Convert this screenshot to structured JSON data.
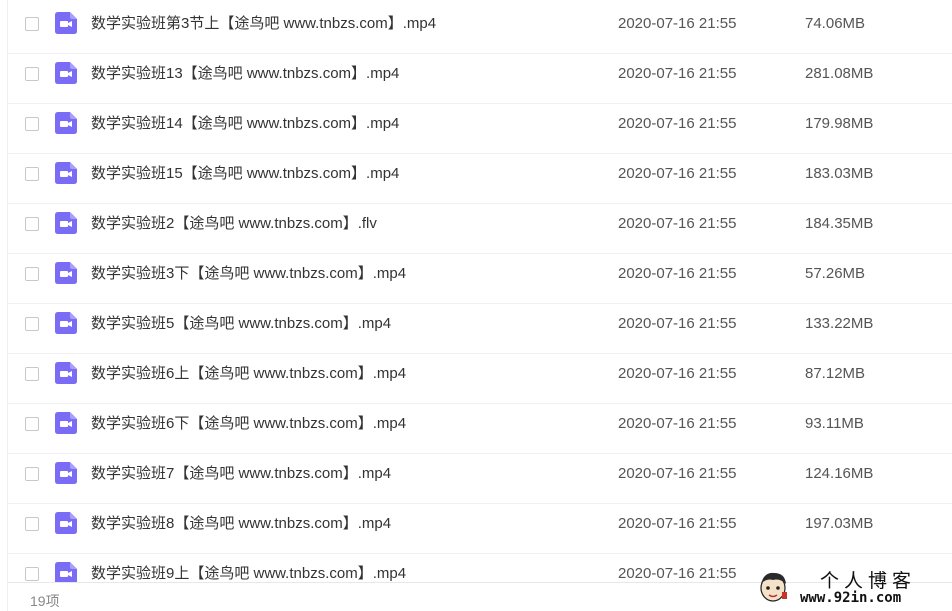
{
  "files": [
    {
      "name": "数学实验班第3节上【途鸟吧 www.tnbzs.com】.mp4",
      "date": "2020-07-16 21:55",
      "size": "74.06MB"
    },
    {
      "name": "数学实验班13【途鸟吧 www.tnbzs.com】.mp4",
      "date": "2020-07-16 21:55",
      "size": "281.08MB"
    },
    {
      "name": "数学实验班14【途鸟吧 www.tnbzs.com】.mp4",
      "date": "2020-07-16 21:55",
      "size": "179.98MB"
    },
    {
      "name": "数学实验班15【途鸟吧 www.tnbzs.com】.mp4",
      "date": "2020-07-16 21:55",
      "size": "183.03MB"
    },
    {
      "name": "数学实验班2【途鸟吧 www.tnbzs.com】.flv",
      "date": "2020-07-16 21:55",
      "size": "184.35MB"
    },
    {
      "name": "数学实验班3下【途鸟吧 www.tnbzs.com】.mp4",
      "date": "2020-07-16 21:55",
      "size": "57.26MB"
    },
    {
      "name": "数学实验班5【途鸟吧 www.tnbzs.com】.mp4",
      "date": "2020-07-16 21:55",
      "size": "133.22MB"
    },
    {
      "name": "数学实验班6上【途鸟吧 www.tnbzs.com】.mp4",
      "date": "2020-07-16 21:55",
      "size": "87.12MB"
    },
    {
      "name": "数学实验班6下【途鸟吧 www.tnbzs.com】.mp4",
      "date": "2020-07-16 21:55",
      "size": "93.11MB"
    },
    {
      "name": "数学实验班7【途鸟吧 www.tnbzs.com】.mp4",
      "date": "2020-07-16 21:55",
      "size": "124.16MB"
    },
    {
      "name": "数学实验班8【途鸟吧 www.tnbzs.com】.mp4",
      "date": "2020-07-16 21:55",
      "size": "197.03MB"
    },
    {
      "name": "数学实验班9上【途鸟吧 www.tnbzs.com】.mp4",
      "date": "2020-07-16 21:55",
      "size": ""
    }
  ],
  "file_icon": "video-file-icon",
  "icon_color": "#7b6cf6",
  "footer": {
    "count": "19项"
  },
  "watermark": {
    "title": "个人博客",
    "url": "www.92in.com"
  }
}
